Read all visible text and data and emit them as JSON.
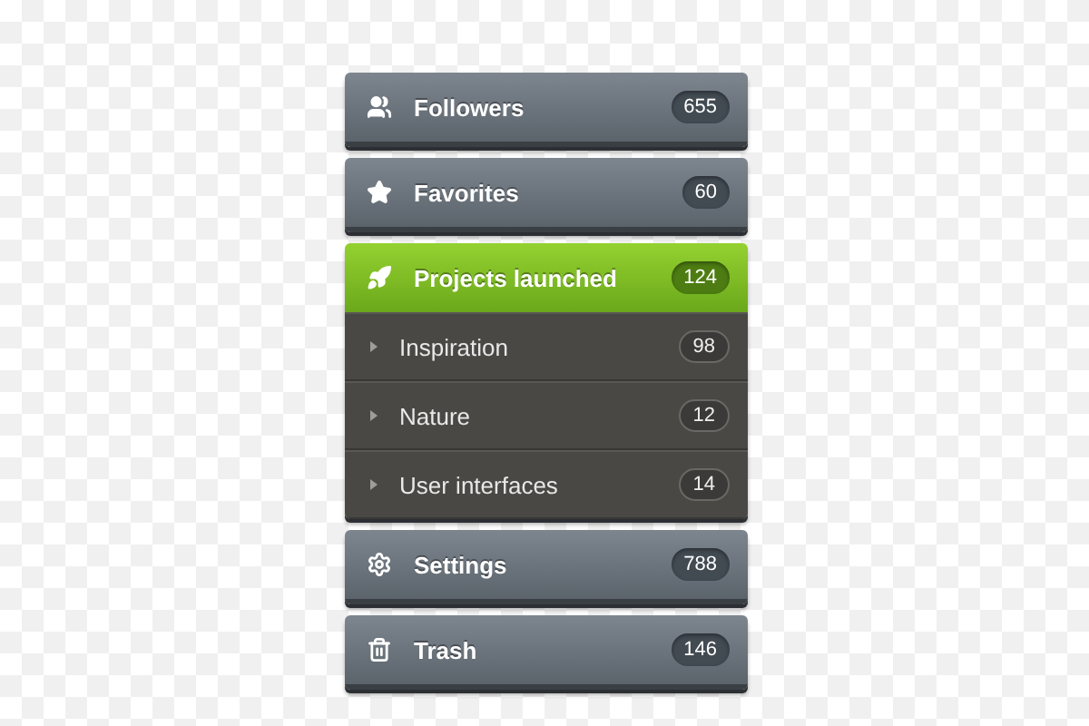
{
  "menu": [
    {
      "label": "Followers",
      "count": "655",
      "selected": false
    },
    {
      "label": "Favorites",
      "count": "60",
      "selected": false
    },
    {
      "label": "Projects launched",
      "count": "124",
      "selected": true,
      "children": [
        {
          "label": "Inspiration",
          "count": "98",
          "selected": false
        },
        {
          "label": "Nature",
          "count": "12",
          "selected": false
        },
        {
          "label": "User interfaces",
          "count": "14",
          "selected": false
        }
      ]
    },
    {
      "label": "Settings",
      "count": "788",
      "selected": false
    },
    {
      "label": "Trash",
      "count": "146",
      "selected": false
    }
  ]
}
